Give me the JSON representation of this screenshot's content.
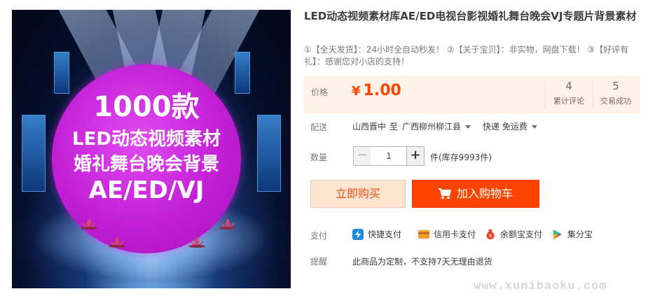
{
  "image": {
    "line1": "1000款",
    "line2": "LED动态视频素材",
    "line3": "婚礼舞台晚会背景",
    "line4": "AE/ED/VJ"
  },
  "product": {
    "title": "LED动态视频素材库AE/ED电视台影视婚礼舞台晚会VJ专题片背景素材",
    "subtitle": "①【全天发货】：24小时全自动秒发！ ②【关于宝贝】：非实物，网盘下载！ ③【好评有礼】：感谢您对小店的支持！"
  },
  "price": {
    "label": "价格",
    "currency": "¥",
    "value": "1.00",
    "reviews_count": "4",
    "reviews_label": "累计评论",
    "sales_count": "5",
    "sales_label": "交易成功"
  },
  "shipping": {
    "label": "配送",
    "from": "山西晋中",
    "to_word": "至",
    "to": "广西柳州柳江县",
    "method": "快递 免运费"
  },
  "quantity": {
    "label": "数量",
    "minus": "−",
    "value": "1",
    "plus": "+",
    "stock": "件(库存9993件)"
  },
  "actions": {
    "buy_now": "立即购买",
    "add_to_cart": "加入购物车"
  },
  "payment": {
    "label": "支付",
    "methods": [
      "快捷支付",
      "信用卡支付",
      "余额宝支付",
      "集分宝"
    ]
  },
  "reminder": {
    "label": "提醒",
    "text": "此商品为定制，不支持7天无理由退货"
  },
  "watermark": "www.xunibaoku.com",
  "colors": {
    "accent": "#ff4400",
    "price_bg": "#fff2e8",
    "buy_now_bg": "#ffe4d0",
    "circle": "#c21fd6"
  }
}
